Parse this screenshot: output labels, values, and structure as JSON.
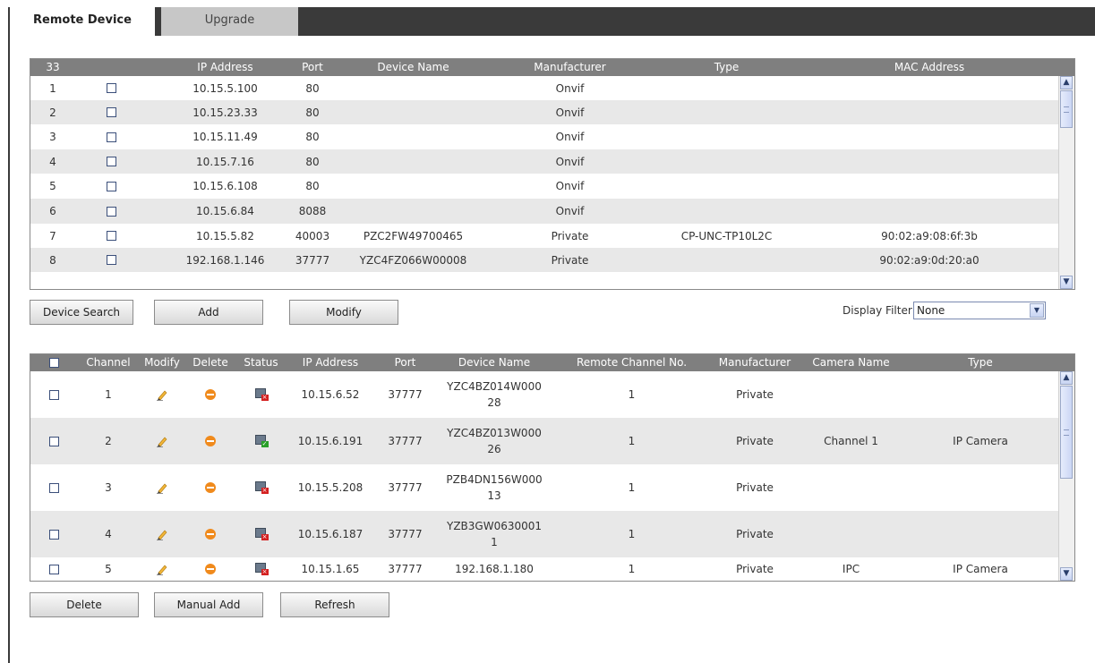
{
  "tabs": [
    {
      "label": "Remote Device",
      "active": true
    },
    {
      "label": "Upgrade",
      "active": false
    }
  ],
  "search_table": {
    "count": "33",
    "columns": [
      "IP Address",
      "Port",
      "Device Name",
      "Manufacturer",
      "Type",
      "MAC Address"
    ],
    "rows": [
      {
        "num": "1",
        "ip": "10.15.5.100",
        "port": "80",
        "name": "",
        "manufacturer": "Onvif",
        "type": "",
        "mac": ""
      },
      {
        "num": "2",
        "ip": "10.15.23.33",
        "port": "80",
        "name": "",
        "manufacturer": "Onvif",
        "type": "",
        "mac": ""
      },
      {
        "num": "3",
        "ip": "10.15.11.49",
        "port": "80",
        "name": "",
        "manufacturer": "Onvif",
        "type": "",
        "mac": ""
      },
      {
        "num": "4",
        "ip": "10.15.7.16",
        "port": "80",
        "name": "",
        "manufacturer": "Onvif",
        "type": "",
        "mac": ""
      },
      {
        "num": "5",
        "ip": "10.15.6.108",
        "port": "80",
        "name": "",
        "manufacturer": "Onvif",
        "type": "",
        "mac": ""
      },
      {
        "num": "6",
        "ip": "10.15.6.84",
        "port": "8088",
        "name": "",
        "manufacturer": "Onvif",
        "type": "",
        "mac": ""
      },
      {
        "num": "7",
        "ip": "10.15.5.82",
        "port": "40003",
        "name": "PZC2FW49700465",
        "manufacturer": "Private",
        "type": "CP-UNC-TP10L2C",
        "mac": "90:02:a9:08:6f:3b"
      },
      {
        "num": "8",
        "ip": "192.168.1.146",
        "port": "37777",
        "name": "YZC4FZ066W00008",
        "manufacturer": "Private",
        "type": "",
        "mac": "90:02:a9:0d:20:a0"
      }
    ]
  },
  "search_buttons": {
    "search": "Device Search",
    "add": "Add",
    "modify": "Modify"
  },
  "display_filter": {
    "label": "Display Filter",
    "value": "None"
  },
  "added_table": {
    "columns": [
      "Channel",
      "Modify",
      "Delete",
      "Status",
      "IP Address",
      "Port",
      "Device Name",
      "Remote Channel No.",
      "Manufacturer",
      "Camera Name",
      "Type"
    ],
    "rows": [
      {
        "channel": "1",
        "status": "offline",
        "ip": "10.15.6.52",
        "port": "37777",
        "name": "YZC4BZ014W00028",
        "remote_ch": "1",
        "manufacturer": "Private",
        "camera": "",
        "type": ""
      },
      {
        "channel": "2",
        "status": "online",
        "ip": "10.15.6.191",
        "port": "37777",
        "name": "YZC4BZ013W00026",
        "remote_ch": "1",
        "manufacturer": "Private",
        "camera": "Channel 1",
        "type": "IP Camera"
      },
      {
        "channel": "3",
        "status": "offline",
        "ip": "10.15.5.208",
        "port": "37777",
        "name": "PZB4DN156W00013",
        "remote_ch": "1",
        "manufacturer": "Private",
        "camera": "",
        "type": ""
      },
      {
        "channel": "4",
        "status": "offline",
        "ip": "10.15.6.187",
        "port": "37777",
        "name": "YZB3GW06300011",
        "remote_ch": "1",
        "manufacturer": "Private",
        "camera": "",
        "type": ""
      },
      {
        "channel": "5",
        "status": "offline",
        "ip": "10.15.1.65",
        "port": "37777",
        "name": "192.168.1.180",
        "remote_ch": "1",
        "manufacturer": "Private",
        "camera": "IPC",
        "type": "IP Camera"
      }
    ]
  },
  "bottom_buttons": {
    "delete": "Delete",
    "manual_add": "Manual Add",
    "refresh": "Refresh"
  },
  "icons": {
    "modify": "pencil-icon",
    "delete": "minus-circle-icon",
    "status_offline": "monitor-x-icon",
    "status_online": "monitor-check-icon"
  },
  "colors": {
    "header": "#7f7f7f",
    "row_alt": "#e8e8e8",
    "frame": "#3a3a3a",
    "delete_icon": "#f08a1c"
  }
}
